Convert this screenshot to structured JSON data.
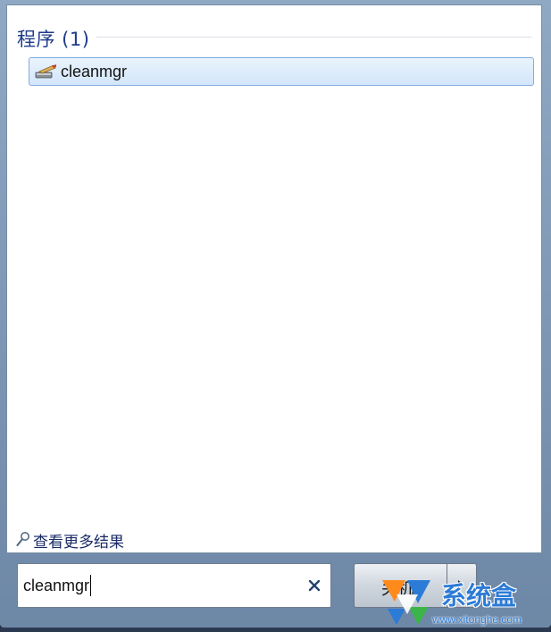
{
  "results": {
    "section_title": "程序 (1)",
    "items": [
      {
        "label": "cleanmgr",
        "icon": "cleanup-tool-icon",
        "selected": true
      }
    ]
  },
  "more_results": {
    "label": "查看更多结果",
    "icon": "search-magnifier-icon"
  },
  "search": {
    "value": "cleanmgr",
    "clear_icon": "clear-x-icon"
  },
  "power": {
    "label": "关机",
    "arrow_icon": "chevron-right-icon"
  },
  "watermark": {
    "brand": "系统盒",
    "url": "www.xitonghe.com"
  },
  "colors": {
    "accent_text": "#1e3b8a",
    "selection_bg": "#d3e6fb",
    "watermark": "#2c7bd6"
  }
}
